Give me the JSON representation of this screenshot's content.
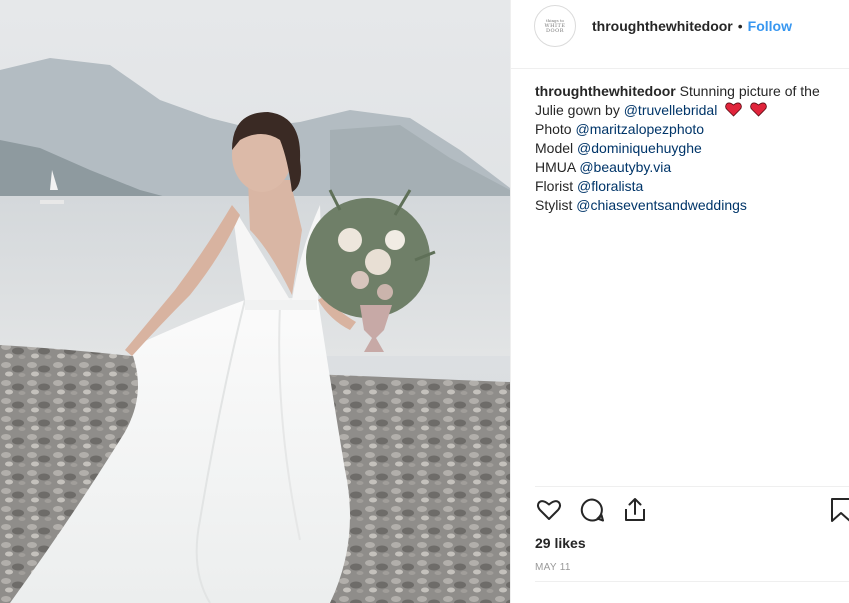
{
  "post": {
    "image_alt": "Bride in white gown holding bouquet on a pebble beach by a misty lake",
    "colors": {
      "link": "#003569",
      "follow": "#3897f0",
      "heart": "#e0243b",
      "text": "#262626",
      "muted": "#999999"
    }
  },
  "header": {
    "avatar_text_top": "things to",
    "avatar_text_main": "WHITE DOOR",
    "username": "throughthewhitedoor",
    "separator": "•",
    "follow_label": "Follow"
  },
  "caption": {
    "username": "throughthewhitedoor",
    "text1": "Stunning picture of the",
    "text2": "Julie gown by ",
    "mention_designer": "@truvellebridal",
    "emoji": "heart-emoji",
    "credits": [
      {
        "label": "Photo ",
        "handle": "@maritzalopezphoto"
      },
      {
        "label": "Model ",
        "handle": "@dominiquehuyghe"
      },
      {
        "label": "HMUA ",
        "handle": "@beautyby.via"
      },
      {
        "label": "Florist ",
        "handle": "@floralista"
      },
      {
        "label": "Stylist ",
        "handle": "@chiaseventsandweddings"
      }
    ]
  },
  "actions": {
    "icons": [
      "heart-icon",
      "comment-icon",
      "share-icon",
      "bookmark-icon"
    ]
  },
  "likes_text": "29 likes",
  "date_text": "MAY 11"
}
